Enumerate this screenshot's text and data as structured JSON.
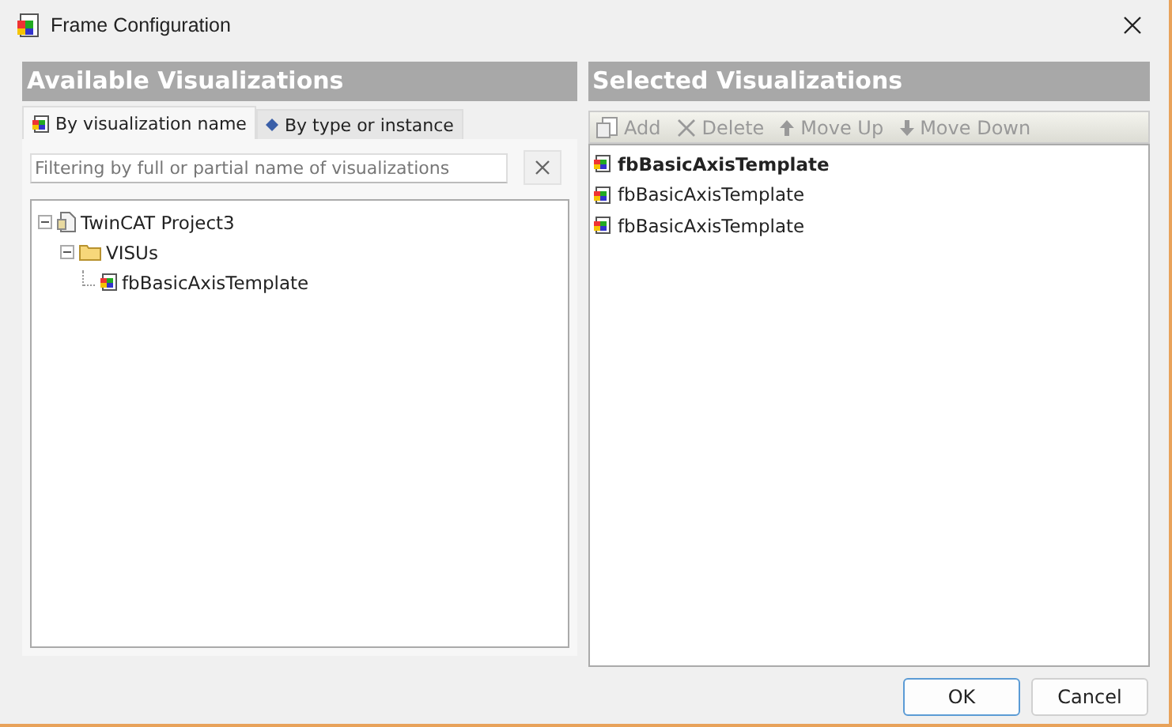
{
  "window": {
    "title": "Frame Configuration"
  },
  "available": {
    "heading": "Available Visualizations",
    "tabs": [
      {
        "label": "By visualization name",
        "selected": true
      },
      {
        "label": "By type or instance",
        "selected": false
      }
    ],
    "filter": {
      "placeholder": "Filtering by full or partial name of visualizations"
    },
    "tree": [
      {
        "label": "TwinCAT Project3",
        "kind": "project",
        "expanded": true,
        "children": [
          {
            "label": "VISUs",
            "kind": "folder",
            "expanded": true,
            "children": [
              {
                "label": "fbBasicAxisTemplate",
                "kind": "visu"
              }
            ]
          }
        ]
      }
    ]
  },
  "selected": {
    "heading": "Selected Visualizations",
    "toolbar": [
      {
        "label": "Add",
        "kind": "add",
        "disabled": true
      },
      {
        "label": "Delete",
        "kind": "delete",
        "disabled": true
      },
      {
        "label": "Move Up",
        "kind": "up",
        "disabled": true
      },
      {
        "label": "Move Down",
        "kind": "down",
        "disabled": true
      }
    ],
    "items": [
      {
        "label": "fbBasicAxisTemplate",
        "bold": true
      },
      {
        "label": "fbBasicAxisTemplate",
        "bold": false
      },
      {
        "label": "fbBasicAxisTemplate",
        "bold": false
      }
    ]
  },
  "buttons": [
    {
      "label": "OK",
      "default": true
    },
    {
      "label": "Cancel",
      "default": false
    }
  ]
}
